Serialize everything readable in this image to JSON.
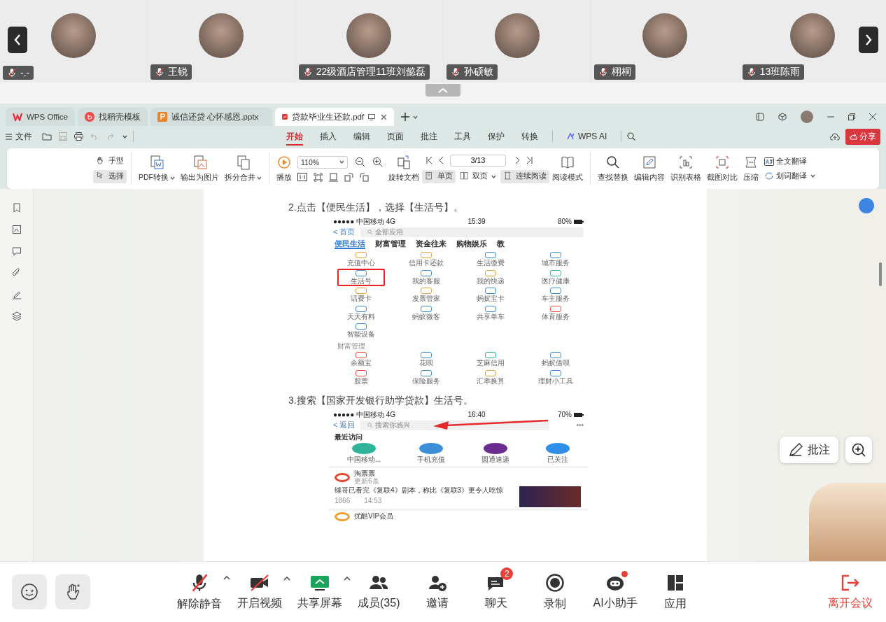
{
  "participants": [
    {
      "name": "-.-",
      "muted": true
    },
    {
      "name": "王锐",
      "muted": true
    },
    {
      "name": "22级酒店管理11班刘懿磊",
      "muted": true
    },
    {
      "name": "孙硕敏",
      "muted": true
    },
    {
      "name": "栩桐",
      "muted": true
    },
    {
      "name": "13班陈雨",
      "muted": true
    }
  ],
  "wps": {
    "tabs": [
      {
        "label": "WPS Office",
        "kind": "home",
        "selected": false
      },
      {
        "label": "找稻壳模板",
        "kind": "docer",
        "selected": false
      },
      {
        "label": "诚信还贷 心怀感恩.pptx",
        "kind": "pptx",
        "selected": false
      },
      {
        "label": "贷款毕业生还款.pdf",
        "kind": "pdf",
        "selected": true
      }
    ],
    "file_menu": "文件",
    "menu_tabs": [
      {
        "label": "开始",
        "selected": true
      },
      {
        "label": "插入",
        "selected": false
      },
      {
        "label": "编辑",
        "selected": false
      },
      {
        "label": "页面",
        "selected": false
      },
      {
        "label": "批注",
        "selected": false
      },
      {
        "label": "工具",
        "selected": false
      },
      {
        "label": "保护",
        "selected": false
      },
      {
        "label": "转换",
        "selected": false
      }
    ],
    "ai_label": "WPS AI",
    "share_button": "分享",
    "ribbon": {
      "tools": [
        {
          "label": "手型",
          "kind": "hand",
          "selected": false
        },
        {
          "label": "选择",
          "kind": "select",
          "selected": true
        }
      ],
      "convert": [
        {
          "label": "PDF转换",
          "kind": "pdf2",
          "dropdown": true
        },
        {
          "label": "输出为图片",
          "kind": "image",
          "dropdown": false
        },
        {
          "label": "拆分合并",
          "kind": "split",
          "dropdown": true
        },
        {
          "label": "播放",
          "kind": "play",
          "dropdown": false
        }
      ],
      "zoom": "110%",
      "rotate": "旋转文档",
      "views": [
        {
          "label": "单页",
          "kind": "single",
          "selected": true,
          "dropdown": false
        },
        {
          "label": "双页",
          "kind": "double",
          "selected": false,
          "dropdown": true
        },
        {
          "label": "连续阅读",
          "kind": "continuous",
          "selected": true,
          "dropdown": false
        }
      ],
      "page": "3/13",
      "read_mode": "阅读模式",
      "tools2": [
        {
          "label": "查找替换",
          "kind": "find"
        },
        {
          "label": "编辑内容",
          "kind": "edit"
        },
        {
          "label": "识别表格",
          "kind": "table"
        },
        {
          "label": "截图对比",
          "kind": "compare"
        },
        {
          "label": "压缩",
          "kind": "compress"
        }
      ],
      "translate": [
        {
          "label": "全文翻译",
          "dropdown": false
        },
        {
          "label": "划词翻译",
          "dropdown": true
        }
      ]
    },
    "document": {
      "steps": [
        {
          "text": "2.点击【便民生活】，选择【生活号】。",
          "shot": {
            "kind": "apps",
            "status": {
              "carrier": "●●●●● 中国移动  4G",
              "time": "15:39",
              "battery": "80%"
            },
            "back": "< 首页",
            "search": "全部应用",
            "tabs": [
              {
                "label": "便民生活",
                "selected": true
              },
              {
                "label": "财富管理",
                "selected": false
              },
              {
                "label": "资金往来",
                "selected": false
              },
              {
                "label": "购物娱乐",
                "selected": false
              },
              {
                "label": "教",
                "selected": false
              }
            ],
            "sections": [
              {
                "items": [
                  {
                    "label": "充值中心",
                    "color": "#f0a040",
                    "highlighted": false
                  },
                  {
                    "label": "信用卡还款",
                    "color": "#f0a040",
                    "highlighted": false
                  },
                  {
                    "label": "生活缴费",
                    "color": "#3d8fd8",
                    "highlighted": false
                  },
                  {
                    "label": "城市服务",
                    "color": "#3d8fd8",
                    "highlighted": false
                  },
                  {
                    "label": "生活号",
                    "color": "#3d8fd8",
                    "highlighted": true
                  },
                  {
                    "label": "我的客服",
                    "color": "#3d8fd8",
                    "highlighted": false
                  },
                  {
                    "label": "我的快递",
                    "color": "#f0a040",
                    "highlighted": false
                  },
                  {
                    "label": "医疗健康",
                    "color": "#2fb49a",
                    "highlighted": false
                  },
                  {
                    "label": "话费卡",
                    "color": "#f0a040",
                    "highlighted": false
                  },
                  {
                    "label": "发票管家",
                    "color": "#f0a040",
                    "highlighted": false
                  },
                  {
                    "label": "蚂蚁宝卡",
                    "color": "#3d8fd8",
                    "highlighted": false
                  },
                  {
                    "label": "车主服务",
                    "color": "#3d8fd8",
                    "highlighted": false
                  },
                  {
                    "label": "天天有料",
                    "color": "#3d8fd8",
                    "highlighted": false
                  },
                  {
                    "label": "蚂蚁微客",
                    "color": "#3d8fd8",
                    "highlighted": false
                  },
                  {
                    "label": "共享单车",
                    "color": "#3d8fd8",
                    "highlighted": false
                  },
                  {
                    "label": "体育服务",
                    "color": "#e8503a",
                    "highlighted": false
                  },
                  {
                    "label": "智能设备",
                    "color": "#3d8fd8",
                    "highlighted": false
                  }
                ]
              },
              {
                "title": "财富管理",
                "items": [
                  {
                    "label": "余额宝",
                    "color": "#e8503a",
                    "highlighted": false
                  },
                  {
                    "label": "花呗",
                    "color": "#3d8fd8",
                    "highlighted": false
                  },
                  {
                    "label": "芝麻信用",
                    "color": "#2fb49a",
                    "highlighted": false
                  },
                  {
                    "label": "蚂蚁借呗",
                    "color": "#3d8fd8",
                    "highlighted": false
                  },
                  {
                    "label": "股票",
                    "color": "#e8503a",
                    "highlighted": false
                  },
                  {
                    "label": "保险服务",
                    "color": "#3d8fd8",
                    "highlighted": false
                  },
                  {
                    "label": "汇率换算",
                    "color": "#f0a040",
                    "highlighted": false
                  },
                  {
                    "label": "理财小工具",
                    "color": "#3d8fd8",
                    "highlighted": false
                  }
                ]
              }
            ]
          }
        },
        {
          "text": "3.搜索【国家开发银行助学贷款】生活号。",
          "shot": {
            "kind": "search",
            "status": {
              "carrier": "●●●●● 中国移动  4G",
              "time": "16:40",
              "battery": "70%"
            },
            "back": "< 返回",
            "search": "搜索你感兴",
            "more": "•••",
            "recent_title": "最近访问",
            "recent": [
              {
                "label": "中国移动...",
                "color": "#2fb49a"
              },
              {
                "label": "手机充值",
                "color": "#3d8fd8"
              },
              {
                "label": "圆通速递",
                "color": "#6a2c91"
              },
              {
                "label": "已关注",
                "color": "#2f8ee8"
              }
            ],
            "feed": {
              "name": "淘票票",
              "sub": "更新6条",
              "headline": "锤哥已看完《复联4》剧本，称比《复联3》更令人吃惊",
              "views": "1866",
              "time": "14:53"
            },
            "next": "优酷VIP会员"
          }
        }
      ]
    },
    "floating": {
      "annotate": "批注"
    }
  },
  "toolbar": {
    "controls": [
      {
        "label": "解除静音",
        "kind": "mic",
        "off": true,
        "menu": true
      },
      {
        "label": "开启视频",
        "kind": "camera",
        "off": true,
        "menu": true
      },
      {
        "label": "共享屏幕",
        "kind": "share",
        "menu": true
      },
      {
        "label": "成员(35)",
        "kind": "members",
        "menu": false
      },
      {
        "label": "邀请",
        "kind": "invite",
        "menu": false
      },
      {
        "label": "聊天",
        "kind": "chat",
        "menu": false,
        "badge": "2"
      },
      {
        "label": "录制",
        "kind": "record",
        "menu": false
      },
      {
        "label": "AI小助手",
        "kind": "ai",
        "menu": false,
        "dot": true
      },
      {
        "label": "应用",
        "kind": "apps",
        "menu": false
      }
    ],
    "leave": "离开会议"
  }
}
